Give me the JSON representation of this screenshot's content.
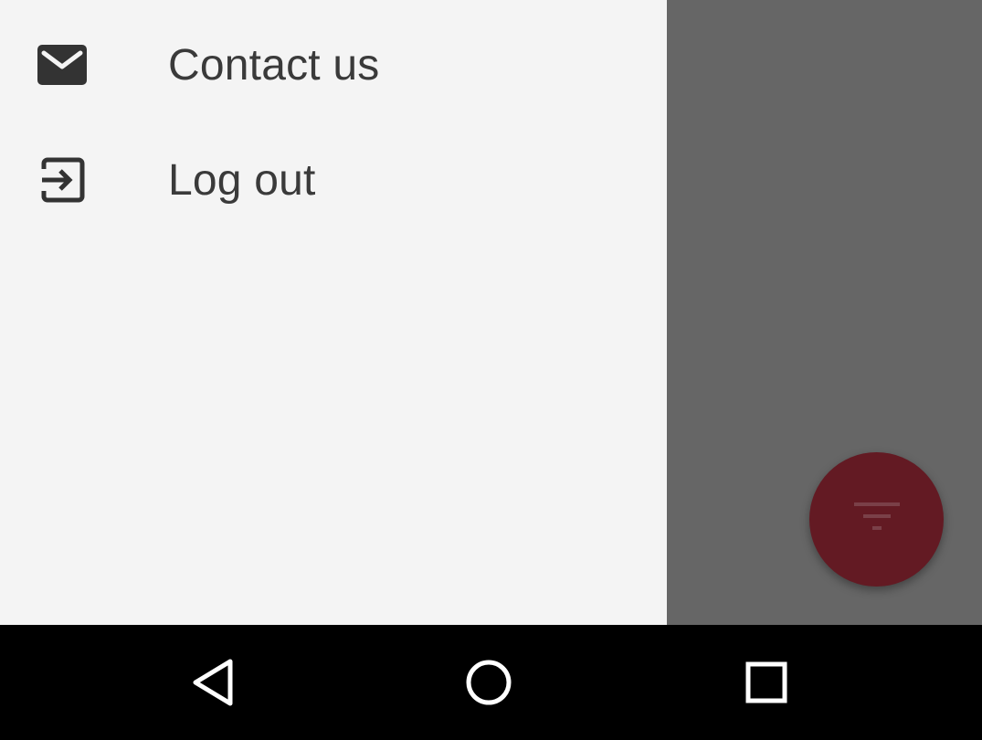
{
  "drawer": {
    "items": [
      {
        "label": "Contact us",
        "icon": "mail-icon"
      },
      {
        "label": "Log out",
        "icon": "exit-icon"
      }
    ]
  },
  "fab": {
    "icon": "filter-icon",
    "color": "#631a23"
  },
  "navbar": {
    "buttons": [
      {
        "icon": "back-triangle-icon"
      },
      {
        "icon": "home-circle-icon"
      },
      {
        "icon": "recents-square-icon"
      }
    ]
  },
  "colors": {
    "drawer_background": "#f4f4f4",
    "scrim": "#666666",
    "text": "#3a3a3a",
    "navbar": "#000000"
  }
}
